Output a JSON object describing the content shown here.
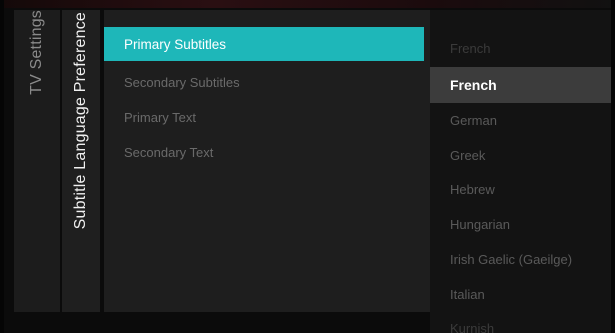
{
  "breadcrumbs": {
    "root": "TV Settings",
    "current": "Subtitle Language Preference"
  },
  "menu": {
    "items": [
      {
        "label": "Primary Subtitles",
        "state": "active"
      },
      {
        "label": "Secondary Subtitles",
        "state": "normal"
      },
      {
        "label": "Primary Text",
        "state": "normal"
      },
      {
        "label": "Secondary Text",
        "state": "normal"
      }
    ],
    "accent_color": "#1eb7b9"
  },
  "languages": {
    "items": [
      {
        "label": "French",
        "state": "faded"
      },
      {
        "label": "French",
        "state": "selected"
      },
      {
        "label": "German",
        "state": "normal"
      },
      {
        "label": "Greek",
        "state": "normal"
      },
      {
        "label": "Hebrew",
        "state": "normal"
      },
      {
        "label": "Hungarian",
        "state": "normal"
      },
      {
        "label": "Irish Gaelic (Gaeilge)",
        "state": "normal"
      },
      {
        "label": "Italian",
        "state": "normal"
      },
      {
        "label": "Kurnish",
        "state": "faded"
      }
    ],
    "selected_color": "#3c3c3c"
  }
}
